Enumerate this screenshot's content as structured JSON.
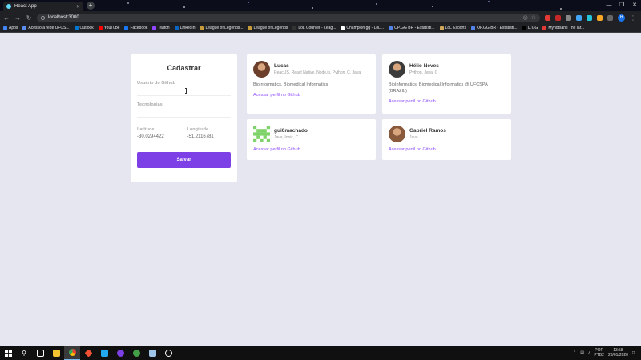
{
  "browser": {
    "tab_title": "React App",
    "tab_close": "✕",
    "new_tab": "+",
    "url": "localhost:3000",
    "win_controls": [
      "—",
      "❐",
      "✕"
    ],
    "bookmarks": [
      {
        "label": "Apps",
        "color": "#4285f4"
      },
      {
        "label": "Acesso à rede UFCS...",
        "color": "#5a8dee"
      },
      {
        "label": "Outlook",
        "color": "#0078d4"
      },
      {
        "label": "YouTube",
        "color": "#ff0000"
      },
      {
        "label": "Facebook",
        "color": "#1877f2"
      },
      {
        "label": "Twitch",
        "color": "#9146ff"
      },
      {
        "label": "LinkedIn",
        "color": "#0a66c2"
      },
      {
        "label": "League of Legends...",
        "color": "#c89b3c"
      },
      {
        "label": "League of Legends",
        "color": "#c89b3c"
      },
      {
        "label": "LoL Counter - Leag...",
        "color": "#333333"
      },
      {
        "label": "Champion.gg - LoL...",
        "color": "#ffffff"
      },
      {
        "label": "OP.GG BR - Estatísti...",
        "color": "#5383e8"
      },
      {
        "label": "LoL Esports",
        "color": "#d0a85c"
      },
      {
        "label": "OP.GG BR - Estatísti...",
        "color": "#5383e8"
      },
      {
        "label": "U.GG",
        "color": "#000000"
      },
      {
        "label": "Mynotsanti The lar...",
        "color": "#e53935"
      }
    ],
    "profile_initial": "H"
  },
  "form": {
    "title": "Cadastrar",
    "github_label": "Usuário do Github",
    "github_value": "",
    "techs_label": "Tecnologias",
    "techs_value": "",
    "latitude_label": "Latitude",
    "latitude_value": "-30,0294422",
    "longitude_label": "Longitude",
    "longitude_value": "-51,2116781",
    "save_label": "Salvar"
  },
  "devs": [
    {
      "name": "Lucas",
      "techs": "ReactJS, React Native, Node.js, Python, C, Java",
      "bio": "BioInformatics, Biomedical Informatics",
      "link": "Acessar perfil no Github",
      "avatar_color": "#6b3f2a"
    },
    {
      "name": "Hélio Neves",
      "techs": "Python, Java, C",
      "bio": "BioInformatics, Biomedical Informatics @ UFCSPA (BRAZIL)",
      "link": "Acessar perfil no Github",
      "avatar_color": "#3b3b3b"
    },
    {
      "name": "gui0machado",
      "techs": "Java, Ionic, C",
      "bio": "",
      "link": "Acessar perfil no Github",
      "avatar_color": "#7fd36a"
    },
    {
      "name": "Gabriel Ramos",
      "techs": "Java",
      "bio": "",
      "link": "Acessar perfil no Github",
      "avatar_color": "#8a5a3c"
    }
  ],
  "taskbar": {
    "lang": "POR",
    "layout": "PTB2",
    "time": "13:58",
    "date": "23/01/2020"
  },
  "colors": {
    "accent": "#7d40e7",
    "link": "#8e4dff",
    "page_bg": "#e5e6f0"
  }
}
